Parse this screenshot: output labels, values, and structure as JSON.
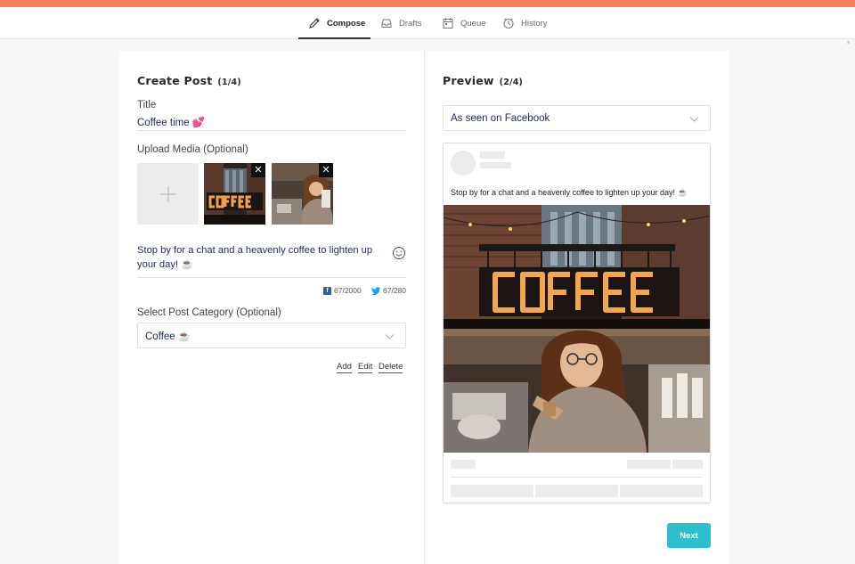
{
  "nav": {
    "tabs": [
      {
        "label": "Compose",
        "icon": "pencil-icon",
        "active": true
      },
      {
        "label": "Drafts",
        "icon": "tray-icon",
        "active": false
      },
      {
        "label": "Queue",
        "icon": "calendar-icon",
        "active": false
      },
      {
        "label": "History",
        "icon": "clock-icon",
        "active": false
      }
    ]
  },
  "colors": {
    "accent_bar": "#fa7f5b",
    "next_button": "#2ebfcf",
    "text_value": "#1e2a5a",
    "facebook": "#3b5998",
    "twitter": "#1da1f2"
  },
  "create": {
    "title": "Create Post",
    "step": "(1/4)",
    "title_label": "Title",
    "title_value": "Coffee time 💕",
    "upload_label": "Upload Media (Optional)",
    "media": [
      {
        "name": "coffee-sign-image"
      },
      {
        "name": "barista-image"
      }
    ],
    "caption": "Stop by for a chat and a heavenly coffee to lighten up your day! ☕",
    "fb_count": "67/2000",
    "tw_count": "67/280",
    "category_label": "Select Post Category (Optional)",
    "category_value": "Coffee ☕",
    "actions": {
      "add": "Add",
      "edit": "Edit",
      "delete": "Delete"
    }
  },
  "preview": {
    "title": "Preview",
    "step": "(2/4)",
    "platform": "As seen on Facebook",
    "caption": "Stop by for a chat and a heavenly coffee to lighten up your day! ☕",
    "next_label": "Next"
  }
}
